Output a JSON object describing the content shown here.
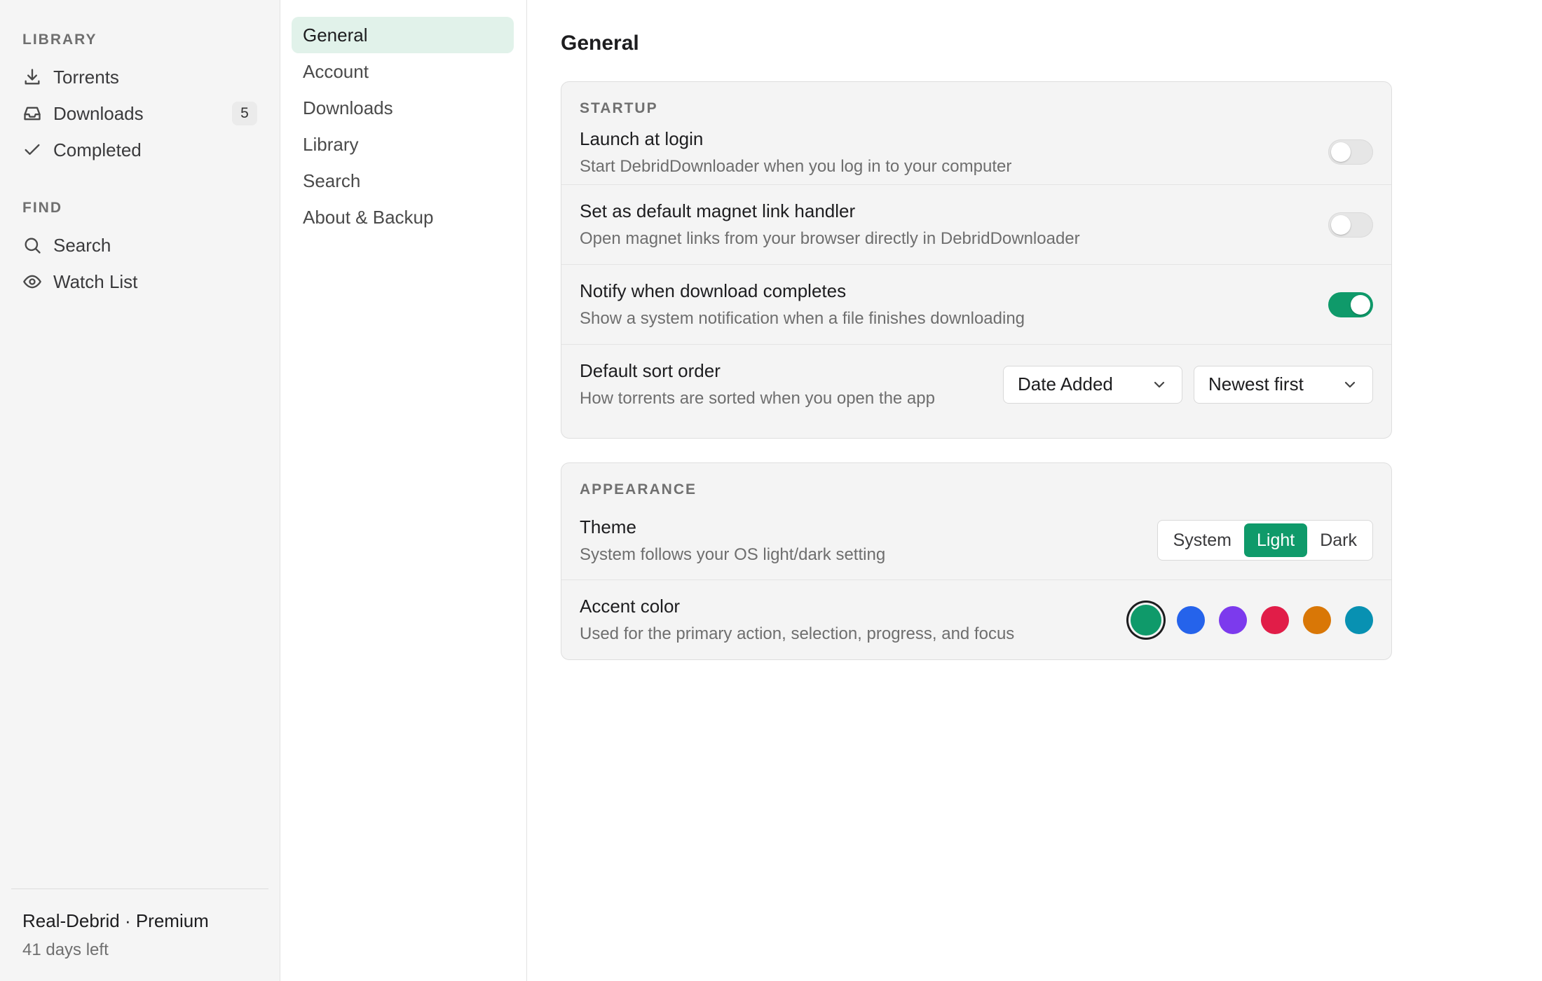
{
  "sidebar": {
    "library_title": "LIBRARY",
    "library_items": [
      {
        "label": "Torrents",
        "icon": "download-icon"
      },
      {
        "label": "Downloads",
        "icon": "inbox-icon",
        "badge": "5"
      },
      {
        "label": "Completed",
        "icon": "check-icon"
      }
    ],
    "find_title": "FIND",
    "find_items": [
      {
        "label": "Search",
        "icon": "search-icon"
      },
      {
        "label": "Watch List",
        "icon": "eye-icon"
      }
    ],
    "footer": {
      "plan": "Real-Debrid · Premium",
      "days_left": "41 days left"
    }
  },
  "settings_nav": {
    "items": [
      "General",
      "Account",
      "Downloads",
      "Library",
      "Search",
      "About & Backup"
    ],
    "active": "General"
  },
  "main": {
    "title": "General",
    "startup": {
      "title": "STARTUP",
      "rows": [
        {
          "title": "Launch at login",
          "desc": "Start DebridDownloader when you log in to your computer",
          "toggle": false
        },
        {
          "title": "Set as default magnet link handler",
          "desc": "Open magnet links from your browser directly in DebridDownloader",
          "toggle": false
        },
        {
          "title": "Notify when download completes",
          "desc": "Show a system notification when a file finishes downloading",
          "toggle": true
        }
      ],
      "sort": {
        "title": "Default sort order",
        "desc": "How torrents are sorted when you open the app",
        "field": "Date Added",
        "direction": "Newest first"
      }
    },
    "appearance": {
      "title": "APPEARANCE",
      "theme": {
        "title": "Theme",
        "desc": "System follows your OS light/dark setting",
        "options": [
          "System",
          "Light",
          "Dark"
        ],
        "selected": "Light"
      },
      "accent": {
        "title": "Accent color",
        "desc": "Used for the primary action, selection, progress, and focus",
        "colors": [
          "#0f9a6a",
          "#2563eb",
          "#7c3aed",
          "#e11d48",
          "#d97706",
          "#0891b2"
        ],
        "selected": "#0f9a6a"
      }
    }
  },
  "colors": {
    "accent": "#0f9a6a",
    "active_nav_bg": "#e1f2ea",
    "sidebar_bg": "#f5f5f5"
  }
}
